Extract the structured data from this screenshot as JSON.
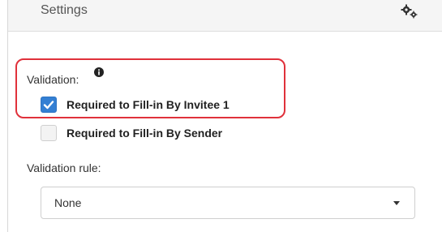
{
  "panel": {
    "title": "Settings",
    "settings_icon": "gears-icon"
  },
  "validation": {
    "label": "Validation:",
    "info_icon": "info-circle-icon",
    "options": [
      {
        "label": "Required to Fill-in By Invitee 1",
        "checked": true
      },
      {
        "label": "Required to Fill-in By Sender",
        "checked": false
      }
    ]
  },
  "validation_rule": {
    "label": "Validation rule:",
    "selected": "None",
    "caret_icon": "chevron-down-icon"
  },
  "colors": {
    "highlight": "#e0313b",
    "checkbox_checked": "#337fd3"
  }
}
